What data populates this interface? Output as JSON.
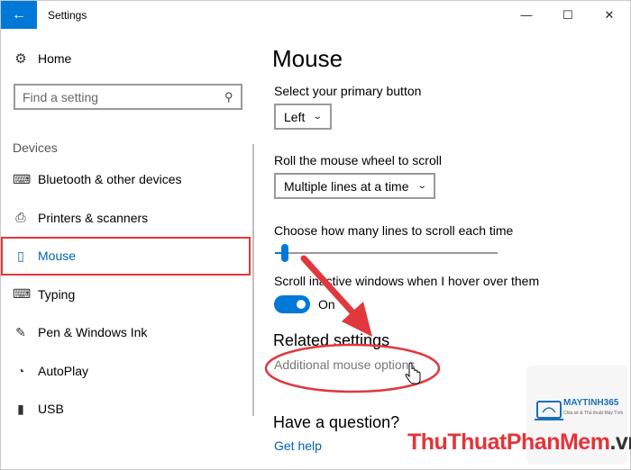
{
  "window": {
    "title": "Settings",
    "back_icon": "back-arrow-icon",
    "minimize_glyph": "—",
    "maximize_glyph": "☐",
    "close_glyph": "✕"
  },
  "sidebar": {
    "home_label": "Home",
    "search_placeholder": "Find a setting",
    "section_label": "Devices",
    "items": [
      {
        "label": "Bluetooth & other devices",
        "icon": "bluetooth-devices-icon",
        "glyph": "⌨"
      },
      {
        "label": "Printers & scanners",
        "icon": "printer-icon",
        "glyph": "⎙"
      },
      {
        "label": "Mouse",
        "icon": "mouse-icon",
        "glyph": "▯",
        "selected": true
      },
      {
        "label": "Typing",
        "icon": "keyboard-icon",
        "glyph": "⌨"
      },
      {
        "label": "Pen & Windows Ink",
        "icon": "pen-icon",
        "glyph": "✎"
      },
      {
        "label": "AutoPlay",
        "icon": "autoplay-icon",
        "glyph": "◔"
      },
      {
        "label": "USB",
        "icon": "usb-icon",
        "glyph": "▮"
      }
    ]
  },
  "main": {
    "title": "Mouse",
    "primary_button_label": "Select your primary button",
    "primary_button_value": "Left",
    "scroll_wheel_label": "Roll the mouse wheel to scroll",
    "scroll_wheel_value": "Multiple lines at a time",
    "lines_label": "Choose how many lines to scroll each time",
    "lines_slider_fraction": 0.03,
    "inactive_scroll_label": "Scroll inactive windows when I hover over them",
    "inactive_scroll_state": "On",
    "related_heading": "Related settings",
    "additional_link": "Additional mouse options",
    "question_heading": "Have a question?",
    "help_link": "Get help"
  },
  "watermark": {
    "brand": "MAYTINH365",
    "brand_tagline": "Chia sẻ & Thủ thuật Máy Tính",
    "site_part1": "ThuThuat",
    "site_part2": "PhanMem",
    "site_part3": ".vn"
  },
  "colors": {
    "accent": "#0078d7",
    "link": "#0063b1",
    "annotation": "#e0383c"
  }
}
